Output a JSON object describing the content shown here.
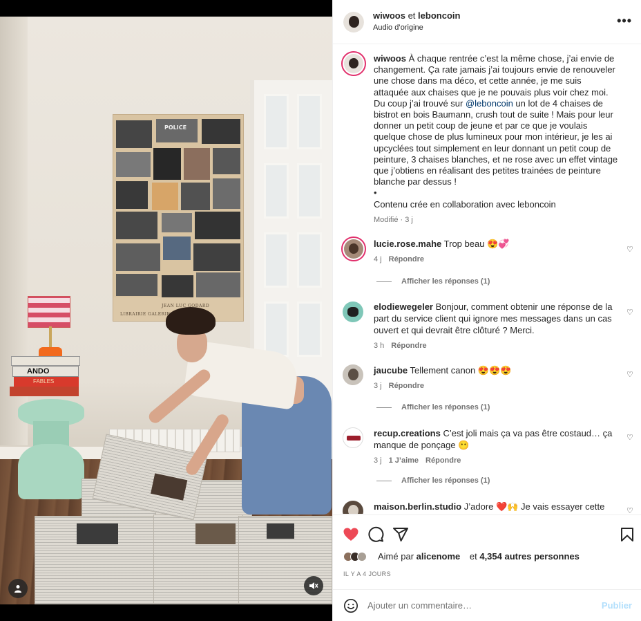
{
  "header": {
    "author": "wiwoos",
    "connector": "et",
    "collaborator": "leboncoin",
    "audio": "Audio d’origine",
    "more_label": "•••"
  },
  "caption": {
    "username": "wiwoos",
    "text_before": " À chaque rentrée c’est la même chose, j’ai envie de changement. Ça rate jamais j’ai toujours envie de renouveler une chose dans ma déco, et cette année, je me suis attaquée aux chaises que je ne pouvais plus voir chez moi. Du coup j’ai trouvé sur ",
    "mention": "@leboncoin",
    "text_after": " un lot de 4 chaises de bistrot en bois Baumann, crush tout de suite ! Mais pour leur donner un petit coup de jeune et par ce que je voulais quelque chose de plus lumineux pour mon intérieur, je les ai upcyclées tout simplement en leur donnant un petit coup de peinture, 3 chaises blanches, et ne rose avec un effet vintage que j’obtiens en réalisant des petites trainées de peinture blanche par dessus !",
    "bullet": "•",
    "collab_note": "Contenu crée en collaboration avec leboncoin",
    "meta": "Modifié · 3 j"
  },
  "comments": [
    {
      "username": "lucie.rose.mahe",
      "text": " Trop beau 😍💞",
      "time": "4 j",
      "likes": "",
      "reply": "Répondre",
      "replies_label": "Afficher les réponses (1)",
      "avatar_color": "#a58a78",
      "ring": true
    },
    {
      "username": "elodiewegeler",
      "text": " Bonjour, comment obtenir une réponse de la part du service client qui ignore mes messages dans un cas ouvert et qui devrait être clôturé ? Merci.",
      "time": "3 h",
      "likes": "",
      "reply": "Répondre",
      "replies_label": "",
      "avatar_color": "#7fc7b8",
      "ring": false
    },
    {
      "username": "jaucube",
      "text": " Tellement canon 😍😍😍",
      "time": "3 j",
      "likes": "",
      "reply": "Répondre",
      "replies_label": "Afficher les réponses (1)",
      "avatar_color": "#8e8a84",
      "ring": false
    },
    {
      "username": "recup.creations",
      "text": " C’est joli mais ça va pas être costaud… ça manque de ponçage 😶",
      "time": "3 j",
      "likes": "1 J’aime",
      "reply": "Répondre",
      "replies_label": "Afficher les réponses (1)",
      "avatar_color": "#ffffff",
      "ring": false
    },
    {
      "username": "maison.berlin.studio",
      "text": " J’adore ❤️🙌 Je vais essayer cette",
      "time": "",
      "likes": "",
      "reply": "",
      "replies_label": "",
      "avatar_color": "#5a4a3e",
      "ring": false
    }
  ],
  "likes": {
    "prefix": "Aimé par",
    "user": "alicenome",
    "connector": "et",
    "others": "4,354 autres personnes"
  },
  "date": "IL Y A 4 JOURS",
  "add_comment": {
    "placeholder": "Ajouter un commentaire…",
    "publish": "Publier"
  },
  "poster_text": "JEAN LUC GODARD",
  "poster_foot": "LIBRAIRIE GALERIE DU JOUR",
  "poster_title": "POLICE",
  "book_titles": [
    "ANDO",
    "FABLES"
  ],
  "colors": {
    "like_red": "#ed4956",
    "link_blue": "#00376b",
    "publish_disabled": "#b2dffc",
    "text_secondary": "#737373"
  }
}
